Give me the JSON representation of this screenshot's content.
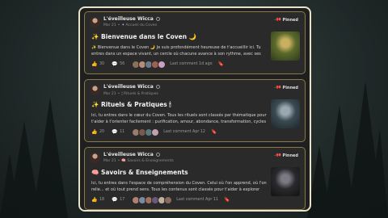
{
  "posts": [
    {
      "author": "L'éveilleuse Wicca",
      "date": "Mar 21",
      "category": "Accueil du Coven",
      "category_icon": "✦",
      "pinned": "Pinned",
      "title": "✨ Bienvenue dans le Coven 🌙",
      "excerpt": "✨ Bienvenue dans le Coven 🌙 Je suis profondément heureuse de t'accueillir ici. Tu entres dans un espace vivant, un cercle où chacune avance à son rythme, avec ses",
      "likes": "30",
      "comments": "56",
      "last_comment": "Last comment 1d ago",
      "avatar_colors": [
        "#8a6f5a",
        "#b88a7a",
        "#6b7a8a",
        "#a06050",
        "#c9a0c0"
      ],
      "thumb_colors": [
        "#5a6a2a",
        "#c8b060",
        "#2f3a1e"
      ]
    },
    {
      "author": "L'éveilleuse Wicca",
      "date": "Mar 21",
      "category": "Rituels & Pratiques",
      "category_icon": "🕯",
      "pinned": "Pinned",
      "title": "✨ Rituels & Pratiques 🕯",
      "excerpt": "Ici, tu entres dans le cœur du Coven. Tous les rituels sont classés par thématique pour t'aider à t'orienter facilement : purification, amour, abondance, transformation, cycles",
      "likes": "20",
      "comments": "11",
      "last_comment": "Last comment Apr 12",
      "avatar_colors": [
        "#9a7a6a",
        "#7a5a4a",
        "#5a7a7a",
        "#c0a0b0"
      ],
      "thumb_colors": [
        "#3a4a52",
        "#9aa8b0",
        "#1e262a"
      ]
    },
    {
      "author": "L'éveilleuse Wicca",
      "date": "Mar 21",
      "category": "Savoirs & Enseignements",
      "category_icon": "🧠",
      "pinned": "Pinned",
      "title": "🧠 Savoirs & Enseignements",
      "excerpt": "Ici, tu entres dans l'espace de compréhension du Coven. Celui où l'on apprend, où l'on relie... et où tout prend sens. Tous les contenus sont classés pour t'aider à explorer",
      "likes": "18",
      "comments": "17",
      "last_comment": "Last comment Apr 11",
      "avatar_colors": [
        "#b08070",
        "#7a8aa0",
        "#a07060",
        "#6a5a7a",
        "#c0b0a0",
        "#8a6a5a"
      ],
      "thumb_colors": [
        "#2a2a2e",
        "#7a7a82",
        "#121214"
      ]
    }
  ],
  "colors": {
    "panel_border": "#e8e2c8",
    "card_border": "#8a7a48",
    "card_bg": "#2a2a2a",
    "accent_purple": "#c9a0ff"
  },
  "icons": {
    "like": "thumb-up-icon",
    "comment": "comment-icon",
    "pin": "pin-icon",
    "bookmark": "bookmark-icon"
  }
}
